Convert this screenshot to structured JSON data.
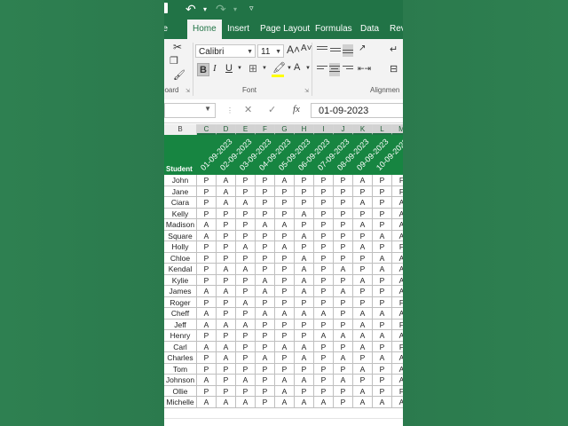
{
  "titlebar": {
    "undo_icon": "undo-icon",
    "redo_icon": "redo-icon"
  },
  "tabs": [
    "ile",
    "Home",
    "Insert",
    "Page Layout",
    "Formulas",
    "Data",
    "Rev"
  ],
  "ribbon": {
    "font_name": "Calibri",
    "font_size": "11",
    "bold": "B",
    "italic": "I",
    "underline": "U",
    "grow": "A˄",
    "shrink": "A˅",
    "font_color": "A",
    "group_clipboard": "board",
    "group_font": "Font",
    "group_alignment": "Alignmen"
  },
  "formula_bar": {
    "cancel": "✕",
    "enter": "✓",
    "fx": "fx",
    "value": "01-09-2023"
  },
  "columns": [
    "B",
    "C",
    "D",
    "E",
    "F",
    "G",
    "H",
    "I",
    "J",
    "K",
    "L",
    "M"
  ],
  "sheet": {
    "student_header": "Student",
    "dates": [
      "01-09-2023",
      "02-09-2023",
      "03-09-2023",
      "04-09-2023",
      "05-09-2023",
      "06-09-2023",
      "07-09-2023",
      "08-09-2023",
      "09-09-2023",
      "10-09-2023"
    ],
    "rows": [
      {
        "name": "John",
        "marks": [
          "P",
          "A",
          "P",
          "P",
          "A",
          "P",
          "P",
          "P",
          "A",
          "P",
          "F"
        ]
      },
      {
        "name": "Jane",
        "marks": [
          "P",
          "A",
          "P",
          "P",
          "P",
          "P",
          "P",
          "P",
          "P",
          "P",
          "F"
        ]
      },
      {
        "name": "Ciara",
        "marks": [
          "P",
          "A",
          "A",
          "P",
          "P",
          "P",
          "P",
          "P",
          "A",
          "P",
          "A"
        ]
      },
      {
        "name": "Kelly",
        "marks": [
          "P",
          "P",
          "P",
          "P",
          "P",
          "A",
          "P",
          "P",
          "P",
          "P",
          "A"
        ]
      },
      {
        "name": "Madison",
        "marks": [
          "A",
          "P",
          "P",
          "A",
          "A",
          "P",
          "P",
          "P",
          "A",
          "P",
          "A"
        ]
      },
      {
        "name": "Square",
        "marks": [
          "A",
          "P",
          "P",
          "P",
          "P",
          "A",
          "P",
          "P",
          "P",
          "A",
          "A"
        ]
      },
      {
        "name": "Holly",
        "marks": [
          "P",
          "P",
          "A",
          "P",
          "A",
          "P",
          "P",
          "P",
          "A",
          "P",
          "F"
        ]
      },
      {
        "name": "Chloe",
        "marks": [
          "P",
          "P",
          "P",
          "P",
          "P",
          "A",
          "P",
          "P",
          "P",
          "A",
          "A"
        ]
      },
      {
        "name": "Kendal",
        "marks": [
          "P",
          "A",
          "A",
          "P",
          "P",
          "A",
          "P",
          "A",
          "P",
          "A",
          "A"
        ]
      },
      {
        "name": "Kylie",
        "marks": [
          "P",
          "P",
          "P",
          "A",
          "P",
          "A",
          "P",
          "P",
          "A",
          "P",
          "A"
        ]
      },
      {
        "name": "James",
        "marks": [
          "A",
          "A",
          "P",
          "A",
          "P",
          "A",
          "P",
          "A",
          "P",
          "P",
          "A"
        ]
      },
      {
        "name": "Roger",
        "marks": [
          "P",
          "P",
          "A",
          "P",
          "P",
          "P",
          "P",
          "P",
          "P",
          "P",
          "F"
        ]
      },
      {
        "name": "Cheff",
        "marks": [
          "A",
          "P",
          "P",
          "A",
          "A",
          "A",
          "A",
          "P",
          "A",
          "A",
          "A"
        ]
      },
      {
        "name": "Jeff",
        "marks": [
          "A",
          "A",
          "A",
          "P",
          "P",
          "P",
          "P",
          "P",
          "A",
          "P",
          "F"
        ]
      },
      {
        "name": "Henry",
        "marks": [
          "P",
          "P",
          "P",
          "P",
          "P",
          "P",
          "A",
          "A",
          "A",
          "A",
          "A"
        ]
      },
      {
        "name": "Carl",
        "marks": [
          "A",
          "A",
          "P",
          "P",
          "A",
          "A",
          "P",
          "P",
          "A",
          "P",
          "F"
        ]
      },
      {
        "name": "Charles",
        "marks": [
          "P",
          "A",
          "P",
          "A",
          "P",
          "A",
          "P",
          "A",
          "P",
          "A",
          "A"
        ]
      },
      {
        "name": "Tom",
        "marks": [
          "P",
          "P",
          "P",
          "P",
          "P",
          "P",
          "P",
          "P",
          "A",
          "P",
          "A"
        ]
      },
      {
        "name": "Johnson",
        "marks": [
          "A",
          "P",
          "A",
          "P",
          "A",
          "A",
          "P",
          "A",
          "P",
          "P",
          "A"
        ]
      },
      {
        "name": "Ollie",
        "marks": [
          "P",
          "P",
          "P",
          "P",
          "A",
          "P",
          "P",
          "P",
          "A",
          "P",
          "F"
        ]
      },
      {
        "name": "Michelle",
        "marks": [
          "A",
          "A",
          "A",
          "P",
          "A",
          "A",
          "A",
          "P",
          "A",
          "A",
          "A"
        ]
      }
    ]
  }
}
